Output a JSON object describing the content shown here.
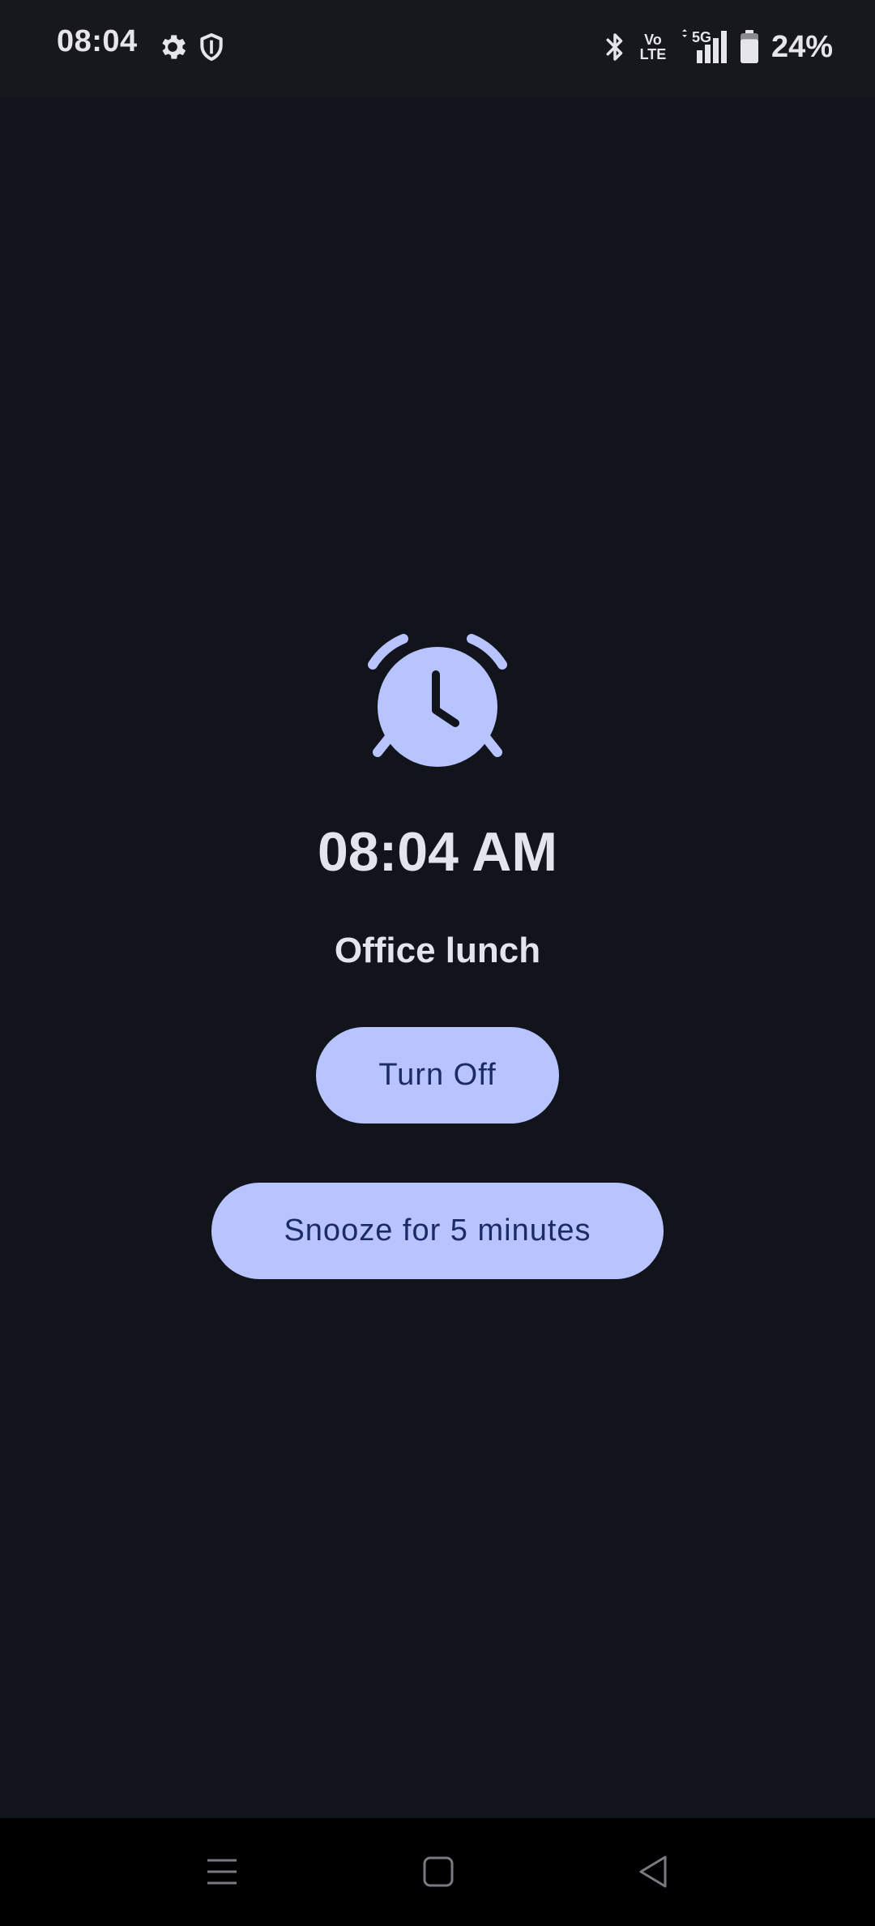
{
  "status_bar": {
    "time": "08:04",
    "volte_top": "Vo",
    "volte_bottom": "LTE",
    "network": "5G",
    "battery_percent": "24%",
    "battery_level": 0.24,
    "icons": [
      "gear-icon",
      "shield-icon",
      "bluetooth-icon",
      "volte-icon",
      "signal-icon",
      "battery-icon"
    ]
  },
  "alarm": {
    "time": "08:04 AM",
    "label": "Office lunch",
    "icon": "alarm-clock-icon",
    "turn_off_label": "Turn Off",
    "snooze_label": "Snooze for 5 minutes"
  },
  "nav_bar": {
    "icons": [
      "menu-icon",
      "home-icon",
      "back-icon"
    ]
  },
  "colors": {
    "background": "#12141c",
    "accent": "#b8c4ff",
    "button_text": "#1c2a66",
    "text": "#e4e4ee"
  }
}
